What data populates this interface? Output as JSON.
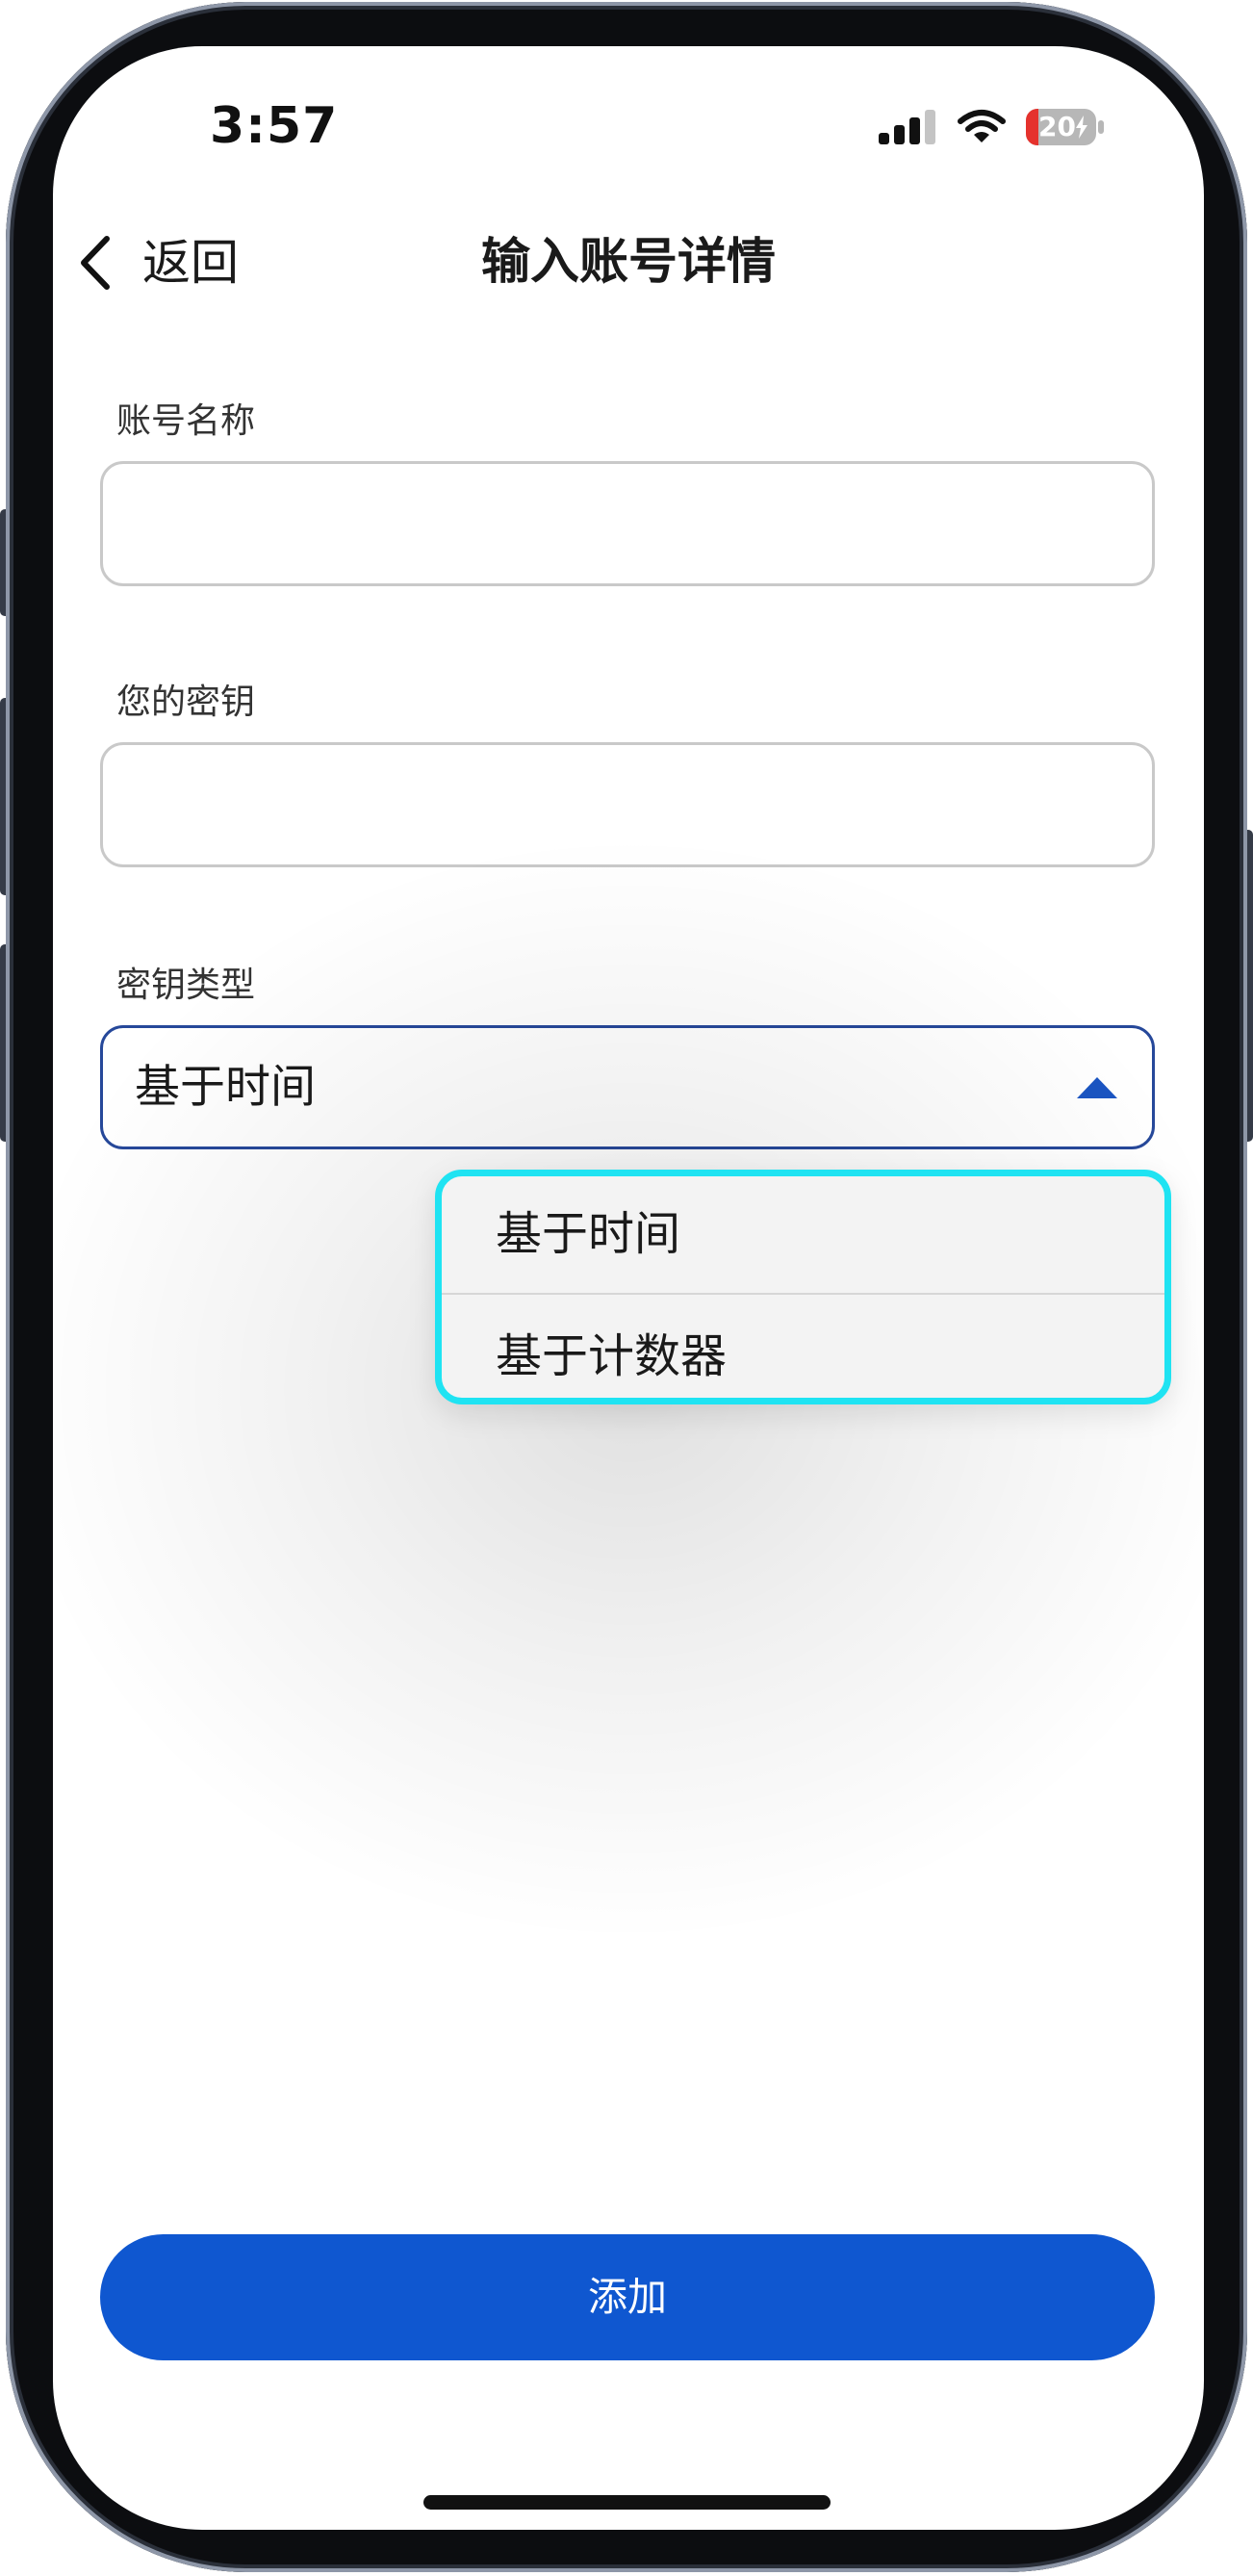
{
  "status_bar": {
    "time": "3:57",
    "battery_level": "20",
    "icons": {
      "signal": "cellular-signal-icon",
      "wifi": "wifi-icon",
      "battery": "battery-icon",
      "charging": "charging-bolt-icon"
    }
  },
  "nav": {
    "back_icon": "chevron-left-icon",
    "back_label": "返回",
    "title": "输入账号详情"
  },
  "form": {
    "account_name": {
      "label": "账号名称",
      "value": ""
    },
    "secret_key": {
      "label": "您的密钥",
      "value": ""
    },
    "key_type": {
      "label": "密钥类型",
      "selected": "基于时间",
      "icon": "caret-up-icon",
      "expanded": true
    }
  },
  "dropdown": {
    "options": [
      "基于时间",
      "基于计数器"
    ]
  },
  "add_button": {
    "label": "添加"
  },
  "colors": {
    "primary_button": "#0f57d0",
    "select_border": "#26489a",
    "dropdown_highlight": "#1fe3f2",
    "input_border": "#c9c9c9",
    "battery_low": "#e5322d",
    "caret": "#1a55c2"
  }
}
